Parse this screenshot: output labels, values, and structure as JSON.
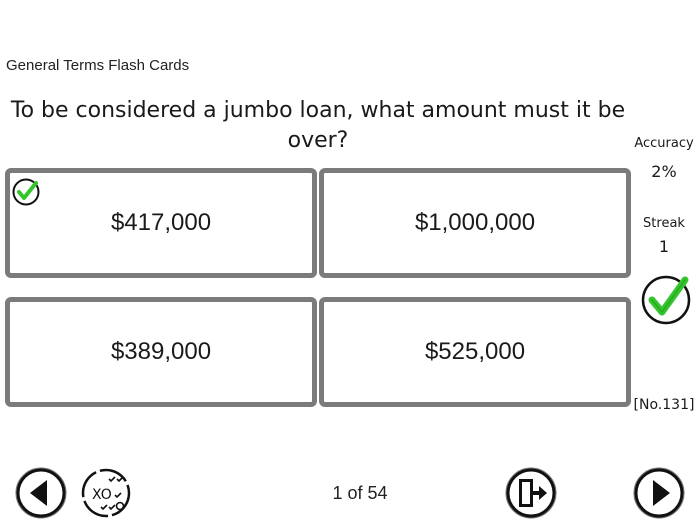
{
  "deck": {
    "title": "General Terms Flash Cards"
  },
  "question": {
    "text": "To be considered a jumbo loan, what amount must it be over?"
  },
  "answers": [
    {
      "label": "$417,000",
      "correct": true
    },
    {
      "label": "$1,000,000"
    },
    {
      "label": "$389,000"
    },
    {
      "label": "$525,000"
    }
  ],
  "stats": {
    "accuracy_label": "Accuracy",
    "accuracy_value": "2%",
    "streak_label": "Streak",
    "streak_value": "1",
    "result_icon": "green-check-icon",
    "card_number": "[No.131]"
  },
  "nav": {
    "page_indicator": "1 of 54",
    "prev_icon": "arrow-left-icon",
    "mode_icon": "tic-tac-toe-icon",
    "exit_icon": "exit-door-icon",
    "next_icon": "arrow-right-icon"
  },
  "colors": {
    "card_border": "#7b7b7b",
    "check_green": "#34c52c",
    "nav_icon": "#111111"
  }
}
